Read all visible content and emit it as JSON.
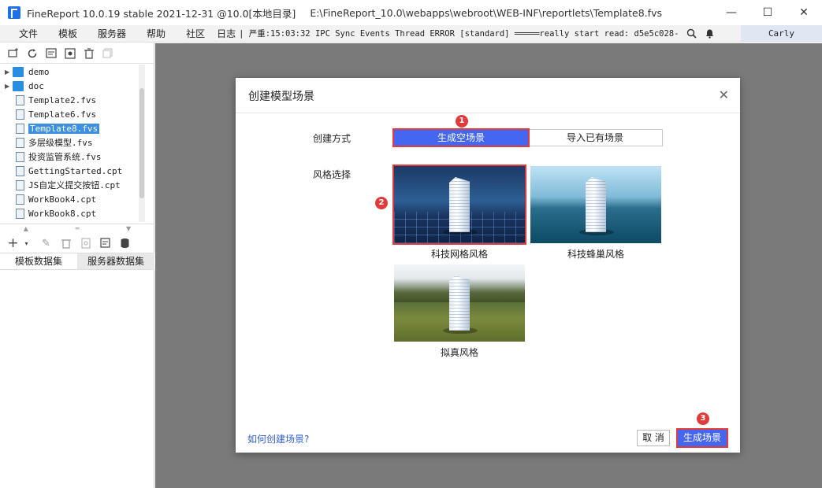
{
  "window": {
    "app_title": "FineReport 10.0.19 stable 2021-12-31 @10.0[本地目录]",
    "path": "E:\\FineReport_10.0\\webapps\\webroot\\WEB-INF\\reportlets\\Template8.fvs",
    "minimize": "—",
    "maximize": "☐",
    "close": "✕"
  },
  "menu": {
    "items": [
      "文件",
      "模板",
      "服务器",
      "帮助",
      "社区",
      "日志"
    ],
    "log": "| 严重:15:03:32 IPC Sync Events Thread ERROR [standard] ═════really start read: d5e5c028-...",
    "user": "Carly"
  },
  "tree": {
    "items": [
      {
        "label": "demo",
        "type": "folder"
      },
      {
        "label": "doc",
        "type": "folder"
      },
      {
        "label": "Template2.fvs",
        "type": "file"
      },
      {
        "label": "Template6.fvs",
        "type": "file"
      },
      {
        "label": "Template8.fvs",
        "type": "file",
        "selected": true
      },
      {
        "label": "多层级模型.fvs",
        "type": "file"
      },
      {
        "label": "投资监管系统.fvs",
        "type": "file"
      },
      {
        "label": "GettingStarted.cpt",
        "type": "file"
      },
      {
        "label": "JS自定义提交按钮.cpt",
        "type": "file"
      },
      {
        "label": "WorkBook4.cpt",
        "type": "file"
      },
      {
        "label": "WorkBook8.cpt",
        "type": "file"
      }
    ]
  },
  "dataset_tabs": [
    "模板数据集",
    "服务器数据集"
  ],
  "dialog": {
    "title": "创建模型场景",
    "close": "✕",
    "method_label": "创建方式",
    "method_options": [
      "生成空场景",
      "导入已有场景"
    ],
    "style_label": "风格选择",
    "styles": [
      "科技网格风格",
      "科技蜂巢风格",
      "拟真风格"
    ],
    "help_link": "如何创建场景?",
    "cancel": "取 消",
    "confirm": "生成场景",
    "badges": [
      "1",
      "2",
      "3"
    ]
  }
}
